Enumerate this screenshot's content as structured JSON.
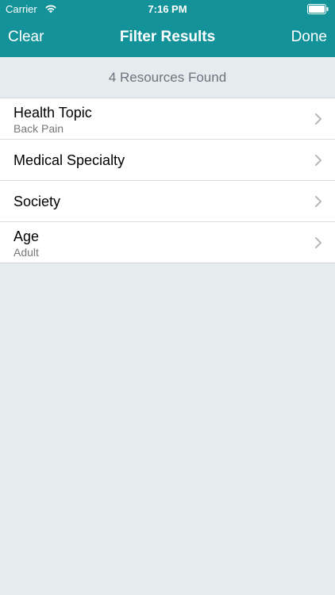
{
  "status_bar": {
    "carrier": "Carrier",
    "time": "7:16 PM",
    "icons": [
      "wifi-icon",
      "battery-icon"
    ]
  },
  "nav": {
    "left_label": "Clear",
    "title": "Filter Results",
    "right_label": "Done",
    "bar_color": "#14929a"
  },
  "summary": {
    "text": "4 Resources Found"
  },
  "filters": [
    {
      "title": "Health Topic",
      "value": "Back Pain"
    },
    {
      "title": "Medical Specialty",
      "value": ""
    },
    {
      "title": "Society",
      "value": ""
    },
    {
      "title": "Age",
      "value": "Adult"
    }
  ]
}
